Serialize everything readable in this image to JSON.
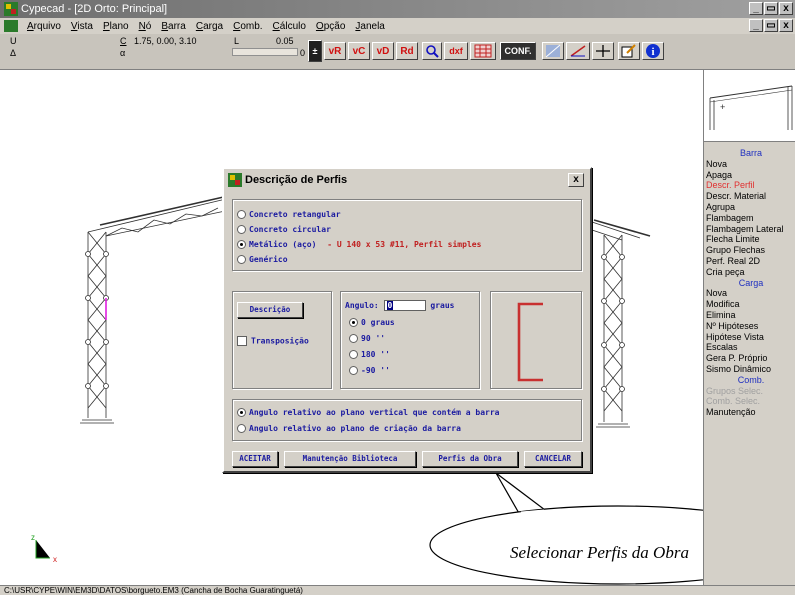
{
  "window": {
    "title": "Cypecad - [2D Orto: Principal]",
    "controls": [
      "_",
      "̷",
      "x"
    ]
  },
  "menu": {
    "items": [
      "Arquivo",
      "Vista",
      "Plano",
      "Nó",
      "Barra",
      "Carga",
      "Comb.",
      "Cálculo",
      "Opção",
      "Janela"
    ]
  },
  "toolbar": {
    "label_u": "U",
    "label_delta": "Δ",
    "label_c": "C",
    "label_alpha": "α",
    "coords": "1.75, 0.00, 3.10",
    "label_l": "L",
    "length": "0.05",
    "length_2": "0",
    "buttons": [
      "vR",
      "vC",
      "vD",
      "Rd",
      "Q",
      "dxf",
      "CONF."
    ]
  },
  "right_panel": {
    "items": [
      {
        "label": "Barra",
        "kind": "head"
      },
      {
        "label": "Nova",
        "kind": "normal"
      },
      {
        "label": "Apaga",
        "kind": "normal"
      },
      {
        "label": "Descr. Perfil",
        "kind": "active"
      },
      {
        "label": "Descr. Material",
        "kind": "normal"
      },
      {
        "label": "Agrupa",
        "kind": "normal"
      },
      {
        "label": "Flambagem",
        "kind": "normal"
      },
      {
        "label": "Flambagem Lateral",
        "kind": "normal"
      },
      {
        "label": "Flecha Limite",
        "kind": "normal"
      },
      {
        "label": "Grupo Flechas",
        "kind": "normal"
      },
      {
        "label": "Perf. Real 2D",
        "kind": "normal"
      },
      {
        "label": "Cria peça",
        "kind": "normal"
      },
      {
        "label": "Carga",
        "kind": "head"
      },
      {
        "label": "Nova",
        "kind": "normal"
      },
      {
        "label": "Modifica",
        "kind": "normal"
      },
      {
        "label": "Elimina",
        "kind": "normal"
      },
      {
        "label": "Nº Hipóteses",
        "kind": "normal"
      },
      {
        "label": "Hipótese Vista",
        "kind": "normal"
      },
      {
        "label": "Escalas",
        "kind": "normal"
      },
      {
        "label": "Gera P. Próprio",
        "kind": "normal"
      },
      {
        "label": "Sismo Dinâmico",
        "kind": "normal"
      },
      {
        "label": "Comb.",
        "kind": "head"
      },
      {
        "label": "Grupos Selec.",
        "kind": "disabled"
      },
      {
        "label": "Comb. Selec.",
        "kind": "disabled"
      },
      {
        "label": "Manutenção",
        "kind": "normal"
      }
    ]
  },
  "dialog": {
    "title": "Descrição de Perfis",
    "close": "x",
    "section_types": [
      {
        "label": "Concreto retangular",
        "selected": false
      },
      {
        "label": "Concreto circular",
        "selected": false
      },
      {
        "label": "Metálico (aço)",
        "selected": true,
        "detail": "- U 140 x 53 #11, Perfil simples"
      },
      {
        "label": "Genérico",
        "selected": false
      }
    ],
    "descricao_button": "Descrição",
    "transposicao_label": "Transposição",
    "angle_label": "Angulo:",
    "angle_value": "0",
    "angle_unit": "graus",
    "angle_options": [
      {
        "label": "0 graus",
        "selected": true
      },
      {
        "label": "90 ''",
        "selected": false
      },
      {
        "label": "180 ''",
        "selected": false
      },
      {
        "label": "-90 ''",
        "selected": false
      }
    ],
    "angle_reference": [
      {
        "label": "Angulo relativo ao plano vertical que contém a barra",
        "selected": true
      },
      {
        "label": "Angulo relativo ao plano de criação da barra",
        "selected": false
      }
    ],
    "buttons": {
      "accept": "ACEITAR",
      "library": "Manutenção Biblioteca",
      "work_profiles": "Perfis da Obra",
      "cancel": "CANCELAR"
    }
  },
  "callout": {
    "text": "Selecionar Perfis da Obra"
  },
  "axes": {
    "z": "z",
    "x": "x"
  },
  "status": {
    "path": "C:\\USR\\CYPE\\WIN\\EM3D\\DATOS\\borgueto.EM3 (Cancha de Bocha Guaratinguetá)"
  },
  "colors": {
    "accent_red": "#e03030",
    "profile_red": "#c83030",
    "mono_blue": "#1a1aa0",
    "panel_head_blue": "#2030c0"
  }
}
